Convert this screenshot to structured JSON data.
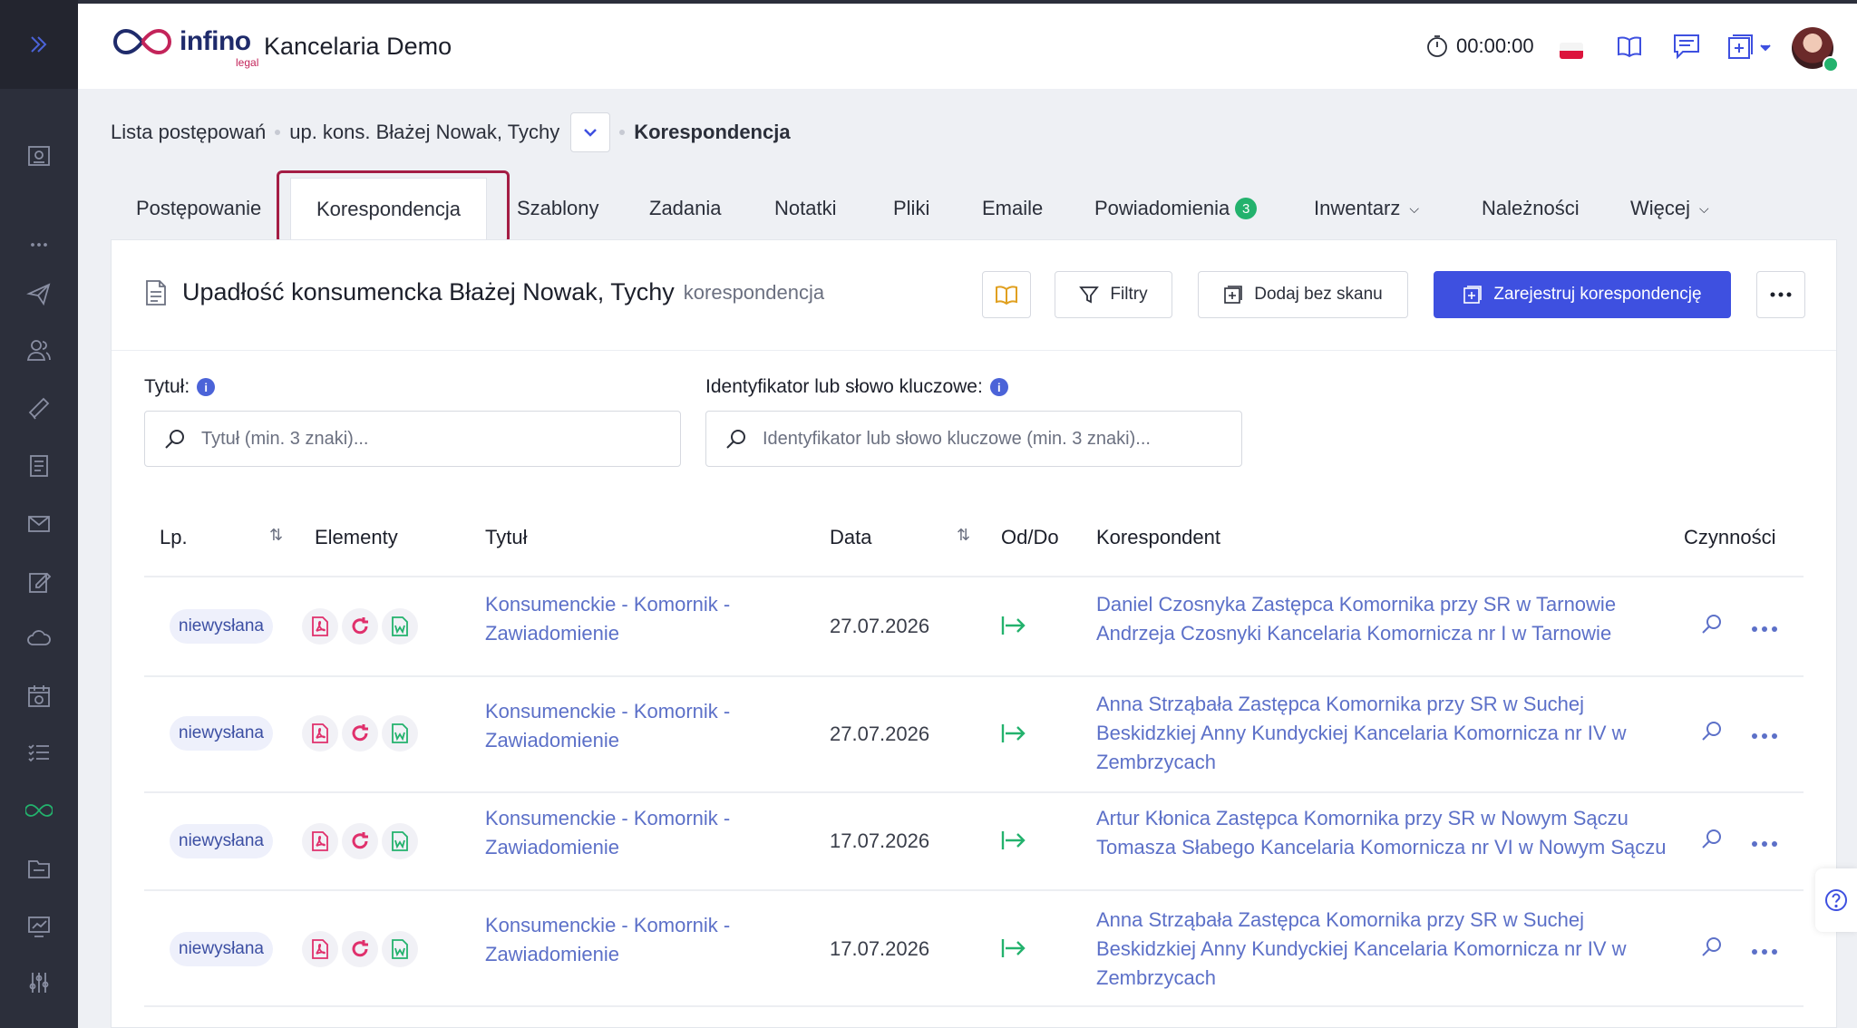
{
  "app": {
    "logo_word": "infino",
    "logo_sub": "legal",
    "title": "Kancelaria Demo",
    "timer": "00:00:00"
  },
  "breadcrumb": {
    "root": "Lista postępowań",
    "case": "up. kons. Błażej Nowak, Tychy",
    "current": "Korespondencja"
  },
  "tabs": [
    {
      "label": "Postępowanie"
    },
    {
      "label": "Korespondencja"
    },
    {
      "label": "Szablony"
    },
    {
      "label": "Zadania"
    },
    {
      "label": "Notatki"
    },
    {
      "label": "Pliki"
    },
    {
      "label": "Emaile"
    },
    {
      "label": "Powiadomienia",
      "badge": "3"
    },
    {
      "label": "Inwentarz"
    },
    {
      "label": "Należności"
    },
    {
      "label": "Więcej"
    }
  ],
  "panel": {
    "title": "Upadłość konsumencka Błażej Nowak, Tychy",
    "subtitle": "korespondencja",
    "filters_btn": "Filtry",
    "add_btn": "Dodaj bez skanu",
    "register_btn": "Zarejestruj korespondencję"
  },
  "filters": {
    "title_label": "Tytuł:",
    "title_placeholder": "Tytuł (min. 3 znaki)...",
    "id_label": "Identyfikator lub słowo kluczowe:",
    "id_placeholder": "Identyfikator lub słowo kluczowe (min. 3 znaki)..."
  },
  "table": {
    "headers": {
      "lp": "Lp.",
      "elements": "Elementy",
      "title": "Tytuł",
      "date": "Data",
      "direction": "Od/Do",
      "correspondent": "Korespondent",
      "actions": "Czynności"
    },
    "rows": [
      {
        "status": "niewysłana",
        "title_l1": "Konsumenckie - Komornik -",
        "title_l2": "Zawiadomienie",
        "date": "27.07.2026",
        "corr_l1": "Daniel Czosnyka Zastępca Komornika przy SR w Tarnowie",
        "corr_l2": "Andrzeja Czosnyki Kancelaria Komornicza nr I w Tarnowie",
        "corr_l3": ""
      },
      {
        "status": "niewysłana",
        "title_l1": "Konsumenckie - Komornik -",
        "title_l2": "Zawiadomienie",
        "date": "27.07.2026",
        "corr_l1": "Anna Strząbała Zastępca Komornika przy SR w Suchej",
        "corr_l2": "Beskidzkiej Anny Kundyckiej Kancelaria Komornicza nr IV w",
        "corr_l3": "Zembrzycach"
      },
      {
        "status": "niewysłana",
        "title_l1": "Konsumenckie - Komornik -",
        "title_l2": "Zawiadomienie",
        "date": "17.07.2026",
        "corr_l1": "Artur Kłonica Zastępca Komornika przy SR w Nowym Sączu",
        "corr_l2": "Tomasza Słabego Kancelaria Komornicza nr VI w Nowym Sączu",
        "corr_l3": ""
      },
      {
        "status": "niewysłana",
        "title_l1": "Konsumenckie - Komornik -",
        "title_l2": "Zawiadomienie",
        "date": "17.07.2026",
        "corr_l1": "Anna Strząbała Zastępca Komornika przy SR w Suchej",
        "corr_l2": "Beskidzkiej Anny Kundyckiej Kancelaria Komornicza nr IV w",
        "corr_l3": "Zembrzycach"
      }
    ]
  },
  "colors": {
    "sidebar": "#2c2f3b",
    "primary": "#3e50e0",
    "link": "#5c70c8",
    "success": "#23b26d",
    "pdf": "#e0306c",
    "highlight": "#a41d44"
  }
}
